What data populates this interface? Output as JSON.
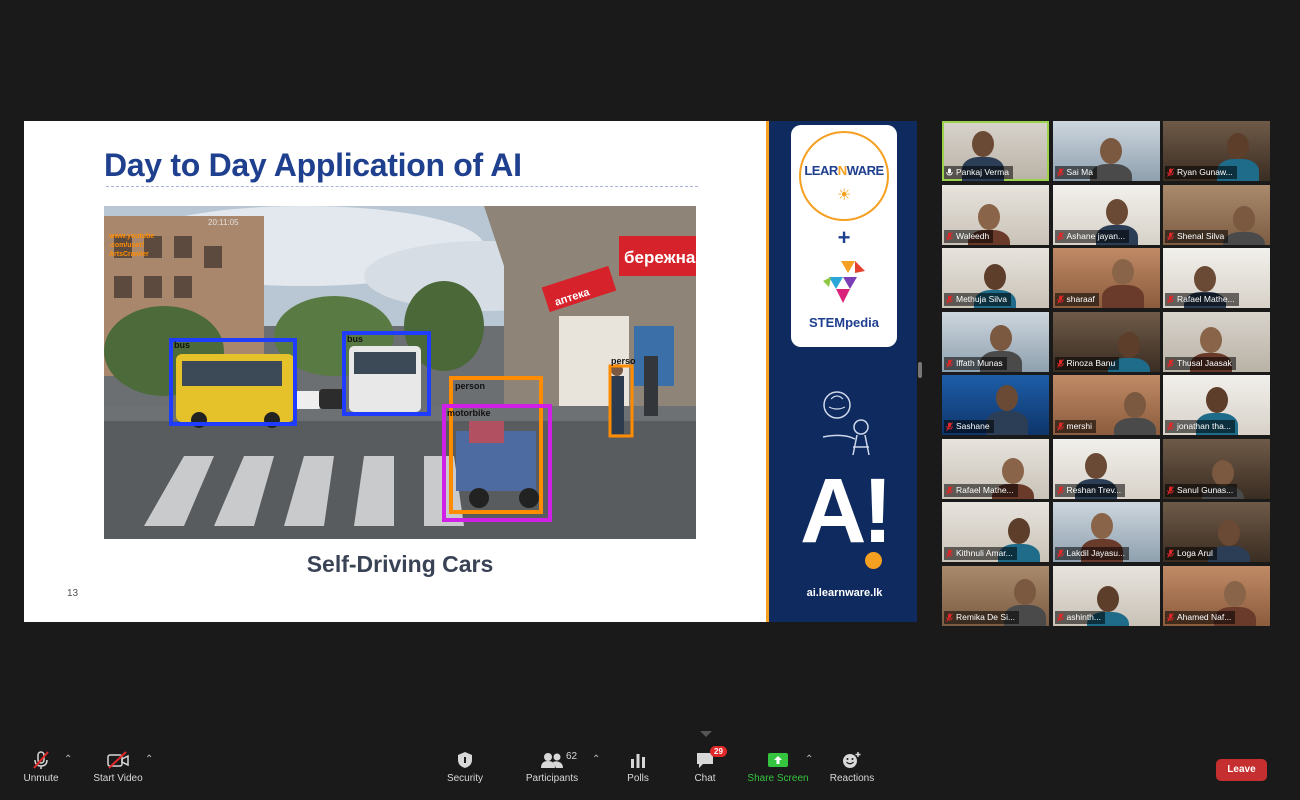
{
  "slide": {
    "title": "Day to Day Application of AI",
    "caption": "Self-Driving Cars",
    "page_number": "13",
    "photo": {
      "overlay_text": [
        "www.youtube",
        ".com/user/",
        "ArtsCrawler",
        "20:11:05"
      ],
      "shop_sign": "бережна",
      "shop_sign_2": "аптека",
      "detections": [
        {
          "label": "bus",
          "color": "#1f3cff"
        },
        {
          "label": "bus",
          "color": "#1f3cff"
        },
        {
          "label": "person",
          "color": "#ff8c00"
        },
        {
          "label": "motorbike",
          "color": "#d020e8"
        },
        {
          "label": "perso",
          "color": "#ff8c00"
        }
      ]
    },
    "side": {
      "learnware_text_a": "LEAR",
      "learnware_text_b": "N",
      "learnware_text_c": "WARE",
      "plus": "+",
      "stempedia": "STEMpedia",
      "ai_logo": "A!",
      "url": "ai.learnware.lk"
    }
  },
  "gallery": {
    "participants": [
      {
        "name": "Pankaj Verma",
        "muted": false,
        "active": true,
        "bg": "tile-bg-a"
      },
      {
        "name": "Sai Ma",
        "muted": true,
        "active": false,
        "bg": "tile-bg-b"
      },
      {
        "name": "Ryan Gunaw...",
        "muted": true,
        "active": false,
        "bg": "tile-bg-c"
      },
      {
        "name": "Waleedh",
        "muted": true,
        "active": false,
        "bg": "tile-bg-d"
      },
      {
        "name": "Ashane jayan...",
        "muted": true,
        "active": false,
        "bg": "tile-bg-f"
      },
      {
        "name": "Shenal Silva",
        "muted": true,
        "active": false,
        "bg": "tile-bg-e"
      },
      {
        "name": "Methuja Silva",
        "muted": true,
        "active": false,
        "bg": "tile-bg-d"
      },
      {
        "name": "sharaaf",
        "muted": true,
        "active": false,
        "bg": "tile-bg-h"
      },
      {
        "name": "Rafael Mathe...",
        "muted": true,
        "active": false,
        "bg": "tile-bg-f"
      },
      {
        "name": "Iffath Munas",
        "muted": true,
        "active": false,
        "bg": "tile-bg-b"
      },
      {
        "name": "Rinoza Banu",
        "muted": true,
        "active": false,
        "bg": "tile-bg-c"
      },
      {
        "name": "Thusal Jaasak",
        "muted": true,
        "active": false,
        "bg": "tile-bg-a"
      },
      {
        "name": "Sashane",
        "muted": true,
        "active": false,
        "bg": "tile-bg-g"
      },
      {
        "name": "mershi",
        "muted": true,
        "active": false,
        "bg": "tile-bg-h"
      },
      {
        "name": "jonathan tha...",
        "muted": true,
        "active": false,
        "bg": "tile-bg-f"
      },
      {
        "name": "Rafael Mathe...",
        "muted": true,
        "active": false,
        "bg": "tile-bg-d"
      },
      {
        "name": "Reshan Trev...",
        "muted": true,
        "active": false,
        "bg": "tile-bg-f"
      },
      {
        "name": "Sanul Gunas...",
        "muted": true,
        "active": false,
        "bg": "tile-bg-c"
      },
      {
        "name": "Kithnuli Amar...",
        "muted": true,
        "active": false,
        "bg": "tile-bg-d"
      },
      {
        "name": "Lakdil Jayasu...",
        "muted": true,
        "active": false,
        "bg": "tile-bg-b"
      },
      {
        "name": "Loga Arul",
        "muted": true,
        "active": false,
        "bg": "tile-bg-c"
      },
      {
        "name": "Remika De Si...",
        "muted": true,
        "active": false,
        "bg": "tile-bg-e"
      },
      {
        "name": "ashinth...",
        "muted": true,
        "active": false,
        "bg": "tile-bg-d"
      },
      {
        "name": "Ahamed Naf...",
        "muted": true,
        "active": false,
        "bg": "tile-bg-h"
      }
    ]
  },
  "toolbar": {
    "unmute": "Unmute",
    "start_video": "Start Video",
    "security": "Security",
    "participants": "Participants",
    "participants_count": "62",
    "polls": "Polls",
    "chat": "Chat",
    "chat_badge": "29",
    "share_screen": "Share Screen",
    "reactions": "Reactions",
    "leave": "Leave"
  },
  "colors": {
    "accent_green": "#35c43f",
    "leave_red": "#c62f2f",
    "title_blue": "#1f3f8f",
    "brand_orange": "#f5a021"
  }
}
